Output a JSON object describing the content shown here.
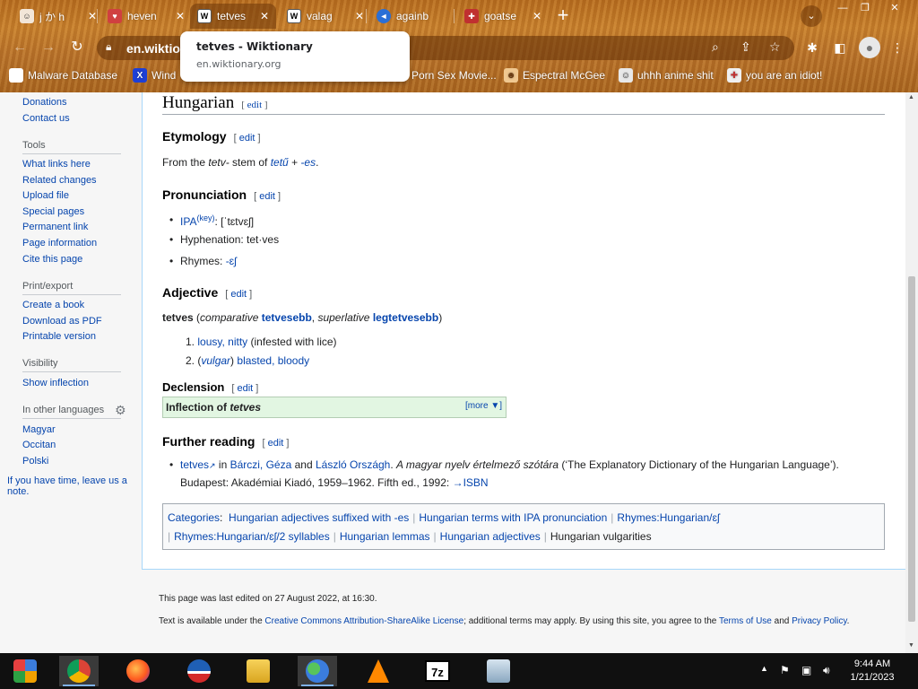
{
  "browser": {
    "tabs": [
      {
        "title": "j か h",
        "fav_color": "#f2e6d8",
        "fav_glyph": "☺"
      },
      {
        "title": "heven",
        "fav_color": "#d04040",
        "fav_glyph": "♥"
      },
      {
        "title": "tetves",
        "fav_color": "#ffffff",
        "fav_glyph": "W"
      },
      {
        "title": "valag",
        "fav_color": "#ffffff",
        "fav_glyph": "W"
      },
      {
        "title": "againb",
        "fav_color": "#2a6fd6",
        "fav_glyph": "◄"
      },
      {
        "title": "goatse",
        "fav_color": "#c03030",
        "fav_glyph": "✚"
      }
    ],
    "active_tab_index": 2,
    "url": "en.wiktionary.org",
    "url_display": "en.wiktio",
    "tooltip": {
      "title": "tetves - Wiktionary",
      "url": "en.wiktionary.org"
    },
    "bookmarks": [
      {
        "label": "Malware Database",
        "icon_color": "#ffffff",
        "glyph": ""
      },
      {
        "label": "Wind",
        "icon_color": "#1d3fd6",
        "glyph": "X"
      },
      {
        "label": "Porn Sex Movie...",
        "icon_color": "#ffffff",
        "glyph": ""
      },
      {
        "label": "Espectral McGee",
        "icon_color": "#f0c890",
        "glyph": "☻"
      },
      {
        "label": "uhhh anime shit",
        "icon_color": "#e8e8e8",
        "glyph": "☺"
      },
      {
        "label": "you are an idiot!",
        "icon_color": "#f0f0f0",
        "glyph": "✚"
      }
    ],
    "accent": "#b86d1f"
  },
  "sidebar": {
    "top_links": [
      "Donations",
      "Contact us"
    ],
    "tools_heading": "Tools",
    "tools": [
      "What links here",
      "Related changes",
      "Upload file",
      "Special pages",
      "Permanent link",
      "Page information",
      "Cite this page"
    ],
    "print_heading": "Print/export",
    "print": [
      "Create a book",
      "Download as PDF",
      "Printable version"
    ],
    "visibility_heading": "Visibility",
    "visibility": [
      "Show inflection"
    ],
    "languages_heading": "In other languages",
    "languages": [
      "Magyar",
      "Occitan",
      "Polski"
    ],
    "note": "If you have time, leave us a note."
  },
  "article": {
    "language": "Hungarian",
    "edit": "edit",
    "etymology_heading": "Etymology",
    "etymology": {
      "pre": "From the ",
      "stem": "tetv-",
      "mid": " stem of ",
      "root": "tetű",
      "plus": " + ",
      "suffix": "-es",
      "end": "."
    },
    "pronunciation_heading": "Pronunciation",
    "ipa_label": "IPA",
    "ipa_key": "(key)",
    "ipa_value": ": [ˈtɛtvɛʃ]",
    "hyphenation": "Hyphenation: tet·ves",
    "rhymes_label": "Rhymes: ",
    "rhymes_value": "-ɛʃ",
    "adjective_heading": "Adjective",
    "headword": "tetves",
    "comparative_label": "comparative",
    "comparative": "tetvesebb",
    "superlative_label": "superlative",
    "superlative": "legtetvesebb",
    "senses": [
      {
        "num": "1.",
        "links": "lousy, nitty",
        "gloss": " (infested with lice)"
      },
      {
        "num": "2.",
        "tag": "vulgar",
        "links": "blasted, bloody"
      }
    ],
    "declension_heading": "Declension",
    "inflection_label": "Inflection of ",
    "inflection_word": "tetves",
    "more": "[more ▼]",
    "further_heading": "Further reading",
    "further": {
      "link": "tetves",
      "in": " in ",
      "author1": "Bárczi, Géza",
      "and": " and ",
      "author2": "László Országh",
      "title": "A magyar nyelv értelmező szótára",
      "trans": " (‘The Explanatory Dictionary of the Hungarian Language’).",
      "line2": "Budapest: Akadémiai Kiadó, 1959–1962. Fifth ed., 1992: ",
      "isbn": "→ISBN"
    },
    "categories_label": "Categories",
    "categories": [
      "Hungarian adjectives suffixed with -es",
      "Hungarian terms with IPA pronunciation",
      "Rhymes:Hungarian/ɛʃ",
      "Rhymes:Hungarian/ɛʃ/2 syllables",
      "Hungarian lemmas",
      "Hungarian adjectives",
      "Hungarian vulgarities"
    ]
  },
  "footer": {
    "edited": "This page was last edited on 27 August 2022, at 16:30.",
    "license_pre": "Text is available under the ",
    "license_link": "Creative Commons Attribution-ShareAlike License",
    "license_mid": "; additional terms may apply. By using this site, you agree to the ",
    "terms": "Terms of Use",
    "and": " and ",
    "privacy": "Privacy Policy",
    "end": "."
  },
  "taskbar": {
    "time": "9:44 AM",
    "date": "1/21/2023"
  }
}
